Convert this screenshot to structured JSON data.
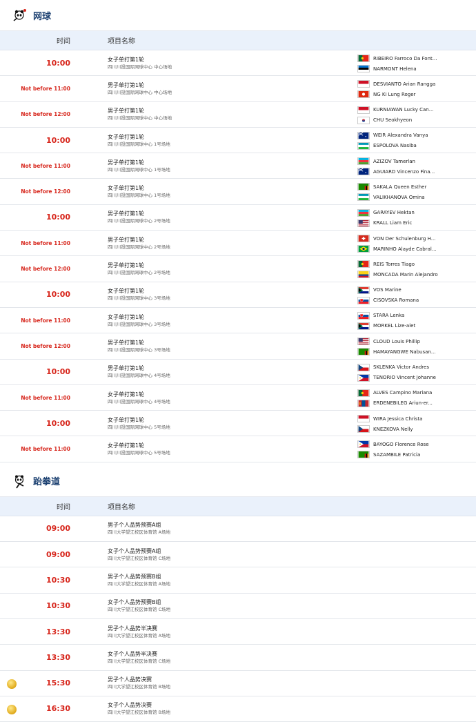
{
  "tennis": {
    "title": "网球",
    "col_time": "时间",
    "col_name": "项目名称",
    "rows": [
      {
        "time": "10:00",
        "small": false,
        "event": "女子单打第1轮",
        "venue": "四川川投国际网球中心 中心场地",
        "p1": "RIBEIRO Farroco Da Font...",
        "f1": "POR",
        "p2": "NARMONT Helena",
        "f2": "EST"
      },
      {
        "time": "Not before 11:00",
        "small": true,
        "event": "男子单打第1轮",
        "venue": "四川川投国际网球中心 中心场地",
        "p1": "DESVIANTO Arian Rangga",
        "f1": "INA",
        "p2": "NG Ki Lung Roger",
        "f2": "HKG"
      },
      {
        "time": "Not before 12:00",
        "small": true,
        "event": "男子单打第1轮",
        "venue": "四川川投国际网球中心 中心场地",
        "p1": "KURNIAWAN Lucky Can...",
        "f1": "INA",
        "p2": "CHU Seokhyeon",
        "f2": "KOR"
      },
      {
        "time": "10:00",
        "small": false,
        "event": "女子单打第1轮",
        "venue": "四川川投国际网球中心 1号场地",
        "p1": "WEIR Alexandra Vanya",
        "f1": "AUS",
        "p2": "ESPOLOVA Nasiba",
        "f2": "UZB"
      },
      {
        "time": "Not before 11:00",
        "small": true,
        "event": "男子单打第1轮",
        "venue": "四川川投国际网球中心 1号场地",
        "p1": "AZIZOV Tamerlan",
        "f1": "AZE",
        "p2": "AGUIARD Vincenzo Fina...",
        "f2": "AUS"
      },
      {
        "time": "Not before 12:00",
        "small": true,
        "event": "女子单打第1轮",
        "venue": "四川川投国际网球中心 1号场地",
        "p1": "SAKALA Queen Esther",
        "f1": "ZAM",
        "p2": "VALIKHANOVA Omina",
        "f2": "UZB"
      },
      {
        "time": "10:00",
        "small": false,
        "event": "男子单打第1轮",
        "venue": "四川川投国际网球中心 2号场地",
        "p1": "GARAYEV Hektan",
        "f1": "AZE",
        "p2": "KRALL Liam Eric",
        "f2": "USA"
      },
      {
        "time": "Not before 11:00",
        "small": true,
        "event": "男子单打第1轮",
        "venue": "四川川投国际网球中心 2号场地",
        "p1": "VON Der Schulenburg H...",
        "f1": "SUI",
        "p2": "MARINHO Alayde Cabral...",
        "f2": "BRA"
      },
      {
        "time": "Not before 12:00",
        "small": true,
        "event": "男子单打第1轮",
        "venue": "四川川投国际网球中心 2号场地",
        "p1": "REIS Torres Tiago",
        "f1": "POR",
        "p2": "MONCADA Marin Alejandro",
        "f2": "COL"
      },
      {
        "time": "10:00",
        "small": false,
        "event": "女子单打第1轮",
        "venue": "四川川投国际网球中心 3号场地",
        "p1": "VOS Marine",
        "f1": "RSA",
        "p2": "CISOVSKA Romana",
        "f2": "SVK"
      },
      {
        "time": "Not before 11:00",
        "small": true,
        "event": "女子单打第1轮",
        "venue": "四川川投国际网球中心 3号场地",
        "p1": "STARA Lenka",
        "f1": "SVK",
        "p2": "MORKEL Lize-alet",
        "f2": "RSA"
      },
      {
        "time": "Not before 12:00",
        "small": true,
        "event": "男子单打第1轮",
        "venue": "四川川投国际网球中心 3号场地",
        "p1": "CLOUD Louis Phillip",
        "f1": "USA",
        "p2": "HAMAYANGWE Nabusan...",
        "f2": "ZAM"
      },
      {
        "time": "10:00",
        "small": false,
        "event": "男子单打第1轮",
        "venue": "四川川投国际网球中心 4号场地",
        "p1": "SKLENKA Victor Andres",
        "f1": "CZE",
        "p2": "TENORIO Vincent Johanne",
        "f2": "PHI"
      },
      {
        "time": "Not before 11:00",
        "small": true,
        "event": "女子单打第1轮",
        "venue": "四川川投国际网球中心 4号场地",
        "p1": "ALVES Campino Mariana",
        "f1": "POR",
        "p2": "ERDENEBILEG Ariun-er...",
        "f2": "MGL"
      },
      {
        "time": "10:00",
        "small": false,
        "event": "女子单打第1轮",
        "venue": "四川川投国际网球中心 5号场地",
        "p1": "WIRA Jessica Christa",
        "f1": "INA",
        "p2": "KNEZKOVA Nelly",
        "f2": "CZE"
      },
      {
        "time": "Not before 11:00",
        "small": true,
        "event": "女子单打第1轮",
        "venue": "四川川投国际网球中心 5号场地",
        "p1": "BAYOGO Florence Rose",
        "f1": "PHI",
        "p2": "SAZAMBILE Patricia",
        "f2": "ZAM"
      }
    ]
  },
  "taekwondo": {
    "title": "跆拳道",
    "col_time": "时间",
    "col_name": "项目名称",
    "rows": [
      {
        "time": "09:00",
        "event": "男子个人品势预赛A组",
        "venue": "四川大学望江校区体育馆 A场地",
        "medal": false
      },
      {
        "time": "09:00",
        "event": "女子个人品势预赛A组",
        "venue": "四川大学望江校区体育馆 C场地",
        "medal": false
      },
      {
        "time": "10:30",
        "event": "男子个人品势预赛B组",
        "venue": "四川大学望江校区体育馆 A场地",
        "medal": false
      },
      {
        "time": "10:30",
        "event": "女子个人品势预赛B组",
        "venue": "四川大学望江校区体育馆 C场地",
        "medal": false
      },
      {
        "time": "13:30",
        "event": "男子个人品势半决赛",
        "venue": "四川大学望江校区体育馆 A场地",
        "medal": false
      },
      {
        "time": "13:30",
        "event": "女子个人品势半决赛",
        "venue": "四川大学望江校区体育馆 C场地",
        "medal": false
      },
      {
        "time": "15:30",
        "event": "男子个人品势决赛",
        "venue": "四川大学望江校区体育馆 B场地",
        "medal": true
      },
      {
        "time": "16:30",
        "event": "女子个人品势决赛",
        "venue": "四川大学望江校区体育馆 B场地",
        "medal": true
      }
    ]
  },
  "colors": {
    "accent_red": "#d7261c",
    "title_blue": "#1a3f70",
    "header_bg": "#eaf1fb"
  }
}
